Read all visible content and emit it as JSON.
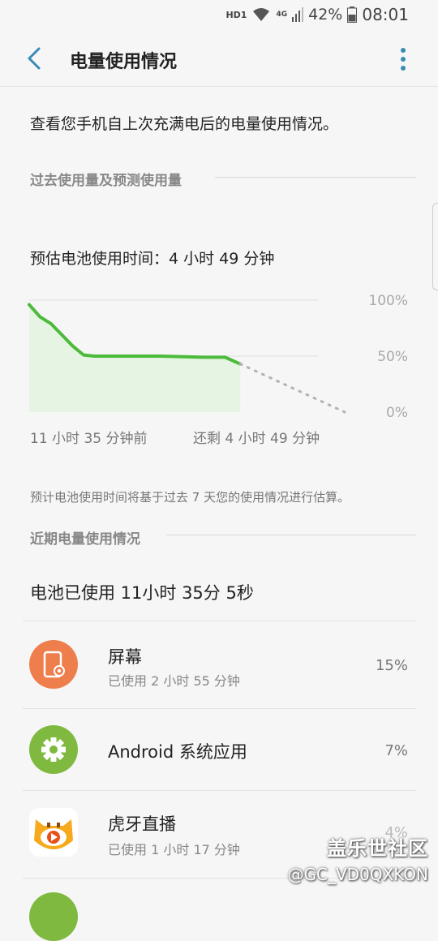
{
  "status": {
    "network_label": "HD1",
    "signal_label": "4G",
    "battery": "42%",
    "time": "08:01"
  },
  "header": {
    "title": "电量使用情况"
  },
  "description": "查看您手机自上次充满电后的电量使用情况。",
  "section_past": "过去使用量及预测使用量",
  "estimate_text": "预估电池使用时间：4 小时 49 分钟",
  "chart_data": {
    "type": "area",
    "y_ticks": [
      "100%",
      "50%",
      "0%"
    ],
    "ylim": [
      0,
      100
    ],
    "x_labels": [
      "11 小时 35 分钟前",
      "还剩 4 小时 49 分钟"
    ],
    "series": [
      {
        "x": [
          0,
          0.5,
          1,
          1.5,
          2,
          2.5,
          3,
          4,
          6,
          8,
          9,
          9.7
        ],
        "values": [
          96,
          85,
          79,
          69,
          59,
          51,
          50,
          50,
          50,
          49,
          49,
          43
        ]
      }
    ],
    "prediction": {
      "x": [
        9.7,
        14.5
      ],
      "values": [
        43,
        0
      ]
    },
    "grid": true,
    "line_color": "#4cbb3b",
    "fill_color": "#e6f4e3",
    "prediction_color": "#b3b3b3"
  },
  "note": "预计电池使用时间将基于过去 7 天您的使用情况进行估算。",
  "section_recent": "近期电量使用情况",
  "battery_used": "电池已使用 11小时 35分 5秒",
  "apps": [
    {
      "name": "屏幕",
      "usage": "已使用 2 小时 55 分钟",
      "percent": "15%",
      "icon": "screen-brightness-icon",
      "color": "#ee7e4c"
    },
    {
      "name": "Android 系统应用",
      "usage": "",
      "percent": "7%",
      "icon": "gear-icon",
      "color": "#7fb93f"
    },
    {
      "name": "虎牙直播",
      "usage": "已使用 1 小时 17 分钟",
      "percent": "4%",
      "icon": "huya-tiger-icon",
      "color": "#f6a91c"
    }
  ],
  "watermark": {
    "line1": "盖乐世社区",
    "line2": "@GC_VD0QXKON"
  }
}
